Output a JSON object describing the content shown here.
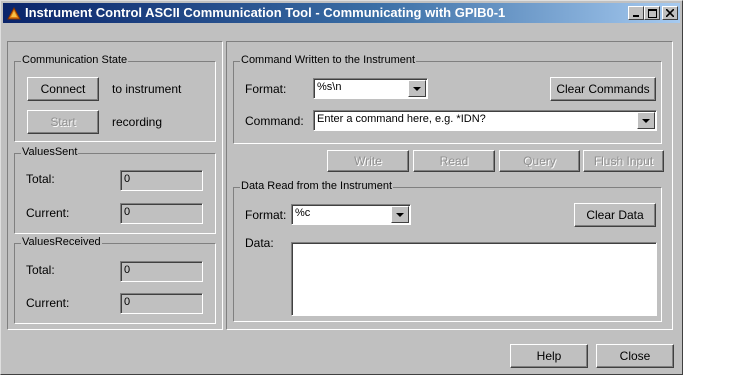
{
  "window": {
    "title": "Instrument Control ASCII Communication Tool - Communicating with GPIB0-1"
  },
  "communication_state": {
    "title": "Communication State",
    "connect_label": "Connect",
    "connect_text": "to instrument",
    "start_label": "Start",
    "start_text": "recording"
  },
  "values_sent": {
    "title": "ValuesSent",
    "total_label": "Total:",
    "total_value": "0",
    "current_label": "Current:",
    "current_value": "0"
  },
  "values_received": {
    "title": "ValuesReceived",
    "total_label": "Total:",
    "total_value": "0",
    "current_label": "Current:",
    "current_value": "0"
  },
  "command_written": {
    "title": "Command Written to the Instrument",
    "format_label": "Format:",
    "format_value": "%s\\n",
    "clear_label": "Clear Commands",
    "command_label": "Command:",
    "command_value": "Enter a command here, e.g. *IDN?"
  },
  "actions": {
    "write": "Write",
    "read": "Read",
    "query": "Query",
    "flush": "Flush Input"
  },
  "data_read": {
    "title": "Data Read from the Instrument",
    "format_label": "Format:",
    "format_value": "%c",
    "clear_label": "Clear Data",
    "data_label": "Data:",
    "data_value": ""
  },
  "footer": {
    "help": "Help",
    "close": "Close"
  },
  "icons": [
    "app-icon",
    "minimize-icon",
    "maximize-icon",
    "close-icon",
    "dropdown-arrow-icon"
  ]
}
